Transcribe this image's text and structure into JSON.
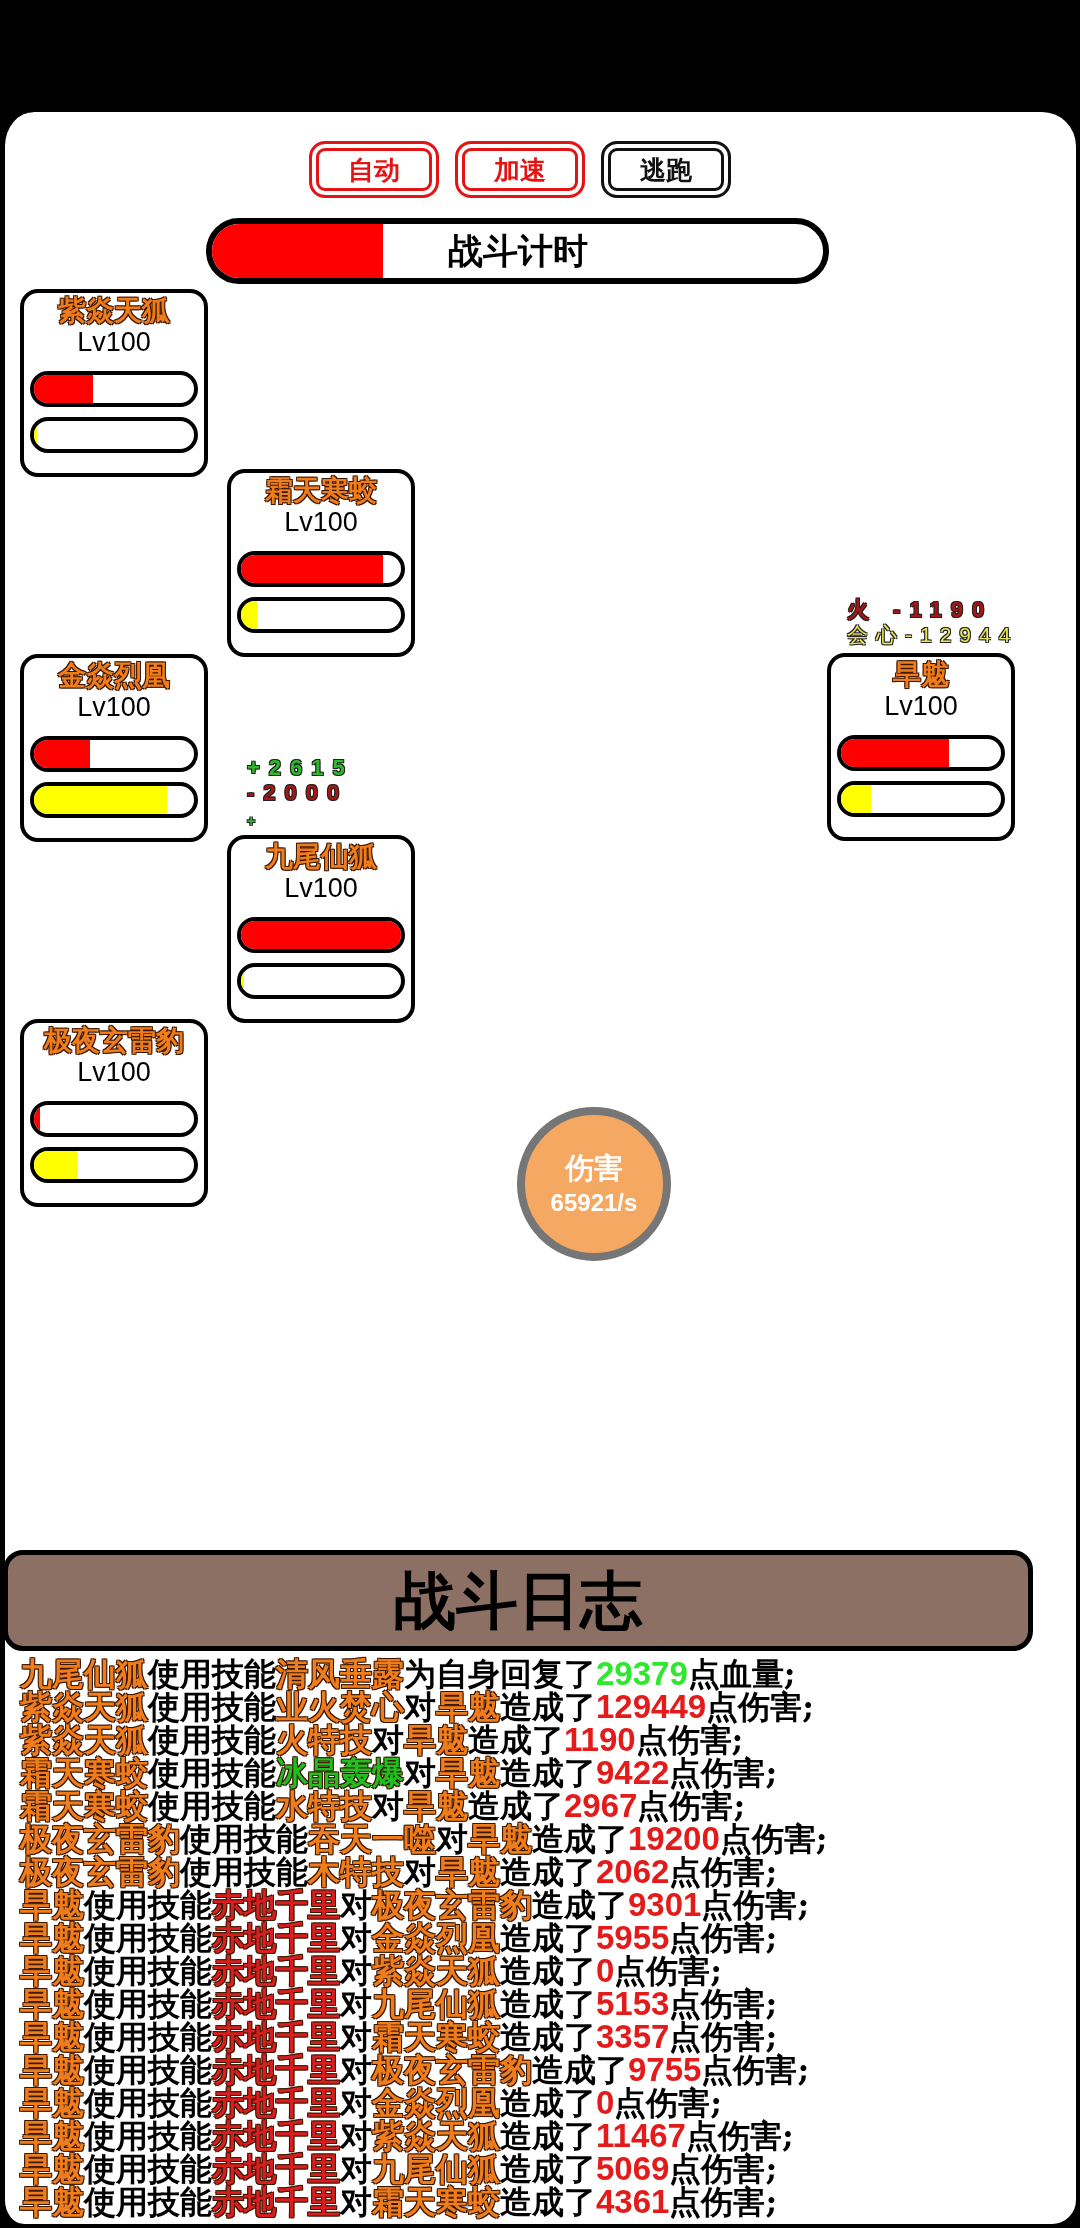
{
  "top_buttons": [
    {
      "label": "自动",
      "on": true
    },
    {
      "label": "加速",
      "on": true
    },
    {
      "label": "逃跑",
      "on": false
    }
  ],
  "timer": {
    "label": "战斗计时",
    "level": 0.28
  },
  "ally_columns": [
    {
      "units": [
        {
          "name": "紫焱天狐",
          "rank": "Lv100",
          "hp_bar": {
            "level": 0.37
          },
          "energy_bar": {
            "level": 0
          }
        },
        {
          "name": "金焱烈凰",
          "rank": "Lv100",
          "hp_bar": {
            "level": 0.35
          },
          "energy_bar": {
            "level": 0.83
          }
        },
        {
          "name": "极夜玄雷豹",
          "rank": "Lv100",
          "hp_bar": {
            "level": 0.04
          },
          "energy_bar": {
            "level": 0.27
          }
        }
      ]
    },
    {
      "units": [
        {
          "name": "霜天寒蛟",
          "rank": "Lv100",
          "hp_bar": {
            "level": 0.885
          },
          "energy_bar": {
            "level": 0.1
          }
        },
        {
          "name": "九尾仙狐",
          "rank": "Lv100",
          "hp_bar": {
            "level": 1
          },
          "energy_bar": {
            "level": 0
          },
          "popups": [
            {
              "text": "+2615",
              "kind": "heal"
            },
            {
              "text": "-2000",
              "kind": "damage"
            },
            {
              "text": "+",
              "kind": "fading"
            }
          ]
        }
      ]
    }
  ],
  "damage_rate": {
    "label": "伤害",
    "value": "65921/s"
  },
  "enemies": [
    {
      "name": "旱魃",
      "rank": "Lv100",
      "hp_bar": {
        "level": 0.675
      },
      "energy_bar": {
        "level": 0.19
      },
      "popups": [
        {
          "text": "火 -1190",
          "kind": "damage"
        },
        {
          "text": "会心-12944",
          "kind": "critical"
        }
      ]
    }
  ],
  "log": {
    "title": "战斗日志",
    "entries": [
      {
        "segments": [
          {
            "text": "九尾仙狐",
            "kind": "unit"
          },
          {
            "text": "使用技能",
            "kind": "text"
          },
          {
            "text": "清风垂露",
            "kind": "skill",
            "color": "#ef7d1b"
          },
          {
            "text": "为自身回复了",
            "kind": "text"
          },
          {
            "text": "29379",
            "kind": "heal"
          },
          {
            "text": "点血量;",
            "kind": "text"
          }
        ]
      },
      {
        "segments": [
          {
            "text": "紫焱天狐",
            "kind": "unit"
          },
          {
            "text": "使用技能",
            "kind": "text"
          },
          {
            "text": "业火焚心",
            "kind": "skill",
            "color": "#ef7d1b"
          },
          {
            "text": "对",
            "kind": "text"
          },
          {
            "text": "旱魃",
            "kind": "unit"
          },
          {
            "text": "造成了",
            "kind": "text"
          },
          {
            "text": "129449",
            "kind": "damage"
          },
          {
            "text": "点伤害;",
            "kind": "text"
          }
        ]
      },
      {
        "segments": [
          {
            "text": "紫焱天狐",
            "kind": "unit"
          },
          {
            "text": "使用技能",
            "kind": "text"
          },
          {
            "text": "火特技",
            "kind": "skill",
            "color": "#ef7d1b"
          },
          {
            "text": "对",
            "kind": "text"
          },
          {
            "text": "旱魃",
            "kind": "unit"
          },
          {
            "text": "造成了",
            "kind": "text"
          },
          {
            "text": "1190",
            "kind": "damage"
          },
          {
            "text": "点伤害;",
            "kind": "text"
          }
        ]
      },
      {
        "segments": [
          {
            "text": "霜天寒蛟",
            "kind": "unit"
          },
          {
            "text": "使用技能",
            "kind": "text"
          },
          {
            "text": "冰晶轰爆",
            "kind": "skill",
            "color": "#1fbf1f"
          },
          {
            "text": "对",
            "kind": "text"
          },
          {
            "text": "旱魃",
            "kind": "unit"
          },
          {
            "text": "造成了",
            "kind": "text"
          },
          {
            "text": "9422",
            "kind": "damage"
          },
          {
            "text": "点伤害;",
            "kind": "text"
          }
        ]
      },
      {
        "segments": [
          {
            "text": "霜天寒蛟",
            "kind": "unit"
          },
          {
            "text": "使用技能",
            "kind": "text"
          },
          {
            "text": "水特技",
            "kind": "skill",
            "color": "#ef7d1b"
          },
          {
            "text": "对",
            "kind": "text"
          },
          {
            "text": "旱魃",
            "kind": "unit"
          },
          {
            "text": "造成了",
            "kind": "text"
          },
          {
            "text": "2967",
            "kind": "damage"
          },
          {
            "text": "点伤害;",
            "kind": "text"
          }
        ]
      },
      {
        "segments": [
          {
            "text": "极夜玄雷豹",
            "kind": "unit"
          },
          {
            "text": "使用技能",
            "kind": "text"
          },
          {
            "text": "吞天一噬",
            "kind": "skill",
            "color": "#ef7d1b"
          },
          {
            "text": "对",
            "kind": "text"
          },
          {
            "text": "旱魃",
            "kind": "unit"
          },
          {
            "text": "造成了",
            "kind": "text"
          },
          {
            "text": "19200",
            "kind": "damage"
          },
          {
            "text": "点伤害;",
            "kind": "text"
          }
        ]
      },
      {
        "segments": [
          {
            "text": "极夜玄雷豹",
            "kind": "unit"
          },
          {
            "text": "使用技能",
            "kind": "text"
          },
          {
            "text": "木特技",
            "kind": "skill",
            "color": "#ef7d1b"
          },
          {
            "text": "对",
            "kind": "text"
          },
          {
            "text": "旱魃",
            "kind": "unit"
          },
          {
            "text": "造成了",
            "kind": "text"
          },
          {
            "text": "2062",
            "kind": "damage"
          },
          {
            "text": "点伤害;",
            "kind": "text"
          }
        ]
      },
      {
        "segments": [
          {
            "text": "旱魃",
            "kind": "unit"
          },
          {
            "text": "使用技能",
            "kind": "text"
          },
          {
            "text": "赤地千里",
            "kind": "skill",
            "color": "#d81e1e"
          },
          {
            "text": "对",
            "kind": "text"
          },
          {
            "text": "极夜玄雷豹",
            "kind": "unit"
          },
          {
            "text": "造成了",
            "kind": "text"
          },
          {
            "text": "9301",
            "kind": "damage"
          },
          {
            "text": "点伤害;",
            "kind": "text"
          }
        ]
      },
      {
        "segments": [
          {
            "text": "旱魃",
            "kind": "unit"
          },
          {
            "text": "使用技能",
            "kind": "text"
          },
          {
            "text": "赤地千里",
            "kind": "skill",
            "color": "#d81e1e"
          },
          {
            "text": "对",
            "kind": "text"
          },
          {
            "text": "金焱烈凰",
            "kind": "unit"
          },
          {
            "text": "造成了",
            "kind": "text"
          },
          {
            "text": "5955",
            "kind": "damage"
          },
          {
            "text": "点伤害;",
            "kind": "text"
          }
        ]
      },
      {
        "segments": [
          {
            "text": "旱魃",
            "kind": "unit"
          },
          {
            "text": "使用技能",
            "kind": "text"
          },
          {
            "text": "赤地千里",
            "kind": "skill",
            "color": "#d81e1e"
          },
          {
            "text": "对",
            "kind": "text"
          },
          {
            "text": "紫焱天狐",
            "kind": "unit"
          },
          {
            "text": "造成了",
            "kind": "text"
          },
          {
            "text": "0",
            "kind": "damage"
          },
          {
            "text": "点伤害;",
            "kind": "text"
          }
        ]
      },
      {
        "segments": [
          {
            "text": "旱魃",
            "kind": "unit"
          },
          {
            "text": "使用技能",
            "kind": "text"
          },
          {
            "text": "赤地千里",
            "kind": "skill",
            "color": "#d81e1e"
          },
          {
            "text": "对",
            "kind": "text"
          },
          {
            "text": "九尾仙狐",
            "kind": "unit"
          },
          {
            "text": "造成了",
            "kind": "text"
          },
          {
            "text": "5153",
            "kind": "damage"
          },
          {
            "text": "点伤害;",
            "kind": "text"
          }
        ]
      },
      {
        "segments": [
          {
            "text": "旱魃",
            "kind": "unit"
          },
          {
            "text": "使用技能",
            "kind": "text"
          },
          {
            "text": "赤地千里",
            "kind": "skill",
            "color": "#d81e1e"
          },
          {
            "text": "对",
            "kind": "text"
          },
          {
            "text": "霜天寒蛟",
            "kind": "unit"
          },
          {
            "text": "造成了",
            "kind": "text"
          },
          {
            "text": "3357",
            "kind": "damage"
          },
          {
            "text": "点伤害;",
            "kind": "text"
          }
        ]
      },
      {
        "segments": [
          {
            "text": "旱魃",
            "kind": "unit"
          },
          {
            "text": "使用技能",
            "kind": "text"
          },
          {
            "text": "赤地千里",
            "kind": "skill",
            "color": "#d81e1e"
          },
          {
            "text": "对",
            "kind": "text"
          },
          {
            "text": "极夜玄雷豹",
            "kind": "unit"
          },
          {
            "text": "造成了",
            "kind": "text"
          },
          {
            "text": "9755",
            "kind": "damage"
          },
          {
            "text": "点伤害;",
            "kind": "text"
          }
        ]
      },
      {
        "segments": [
          {
            "text": "旱魃",
            "kind": "unit"
          },
          {
            "text": "使用技能",
            "kind": "text"
          },
          {
            "text": "赤地千里",
            "kind": "skill",
            "color": "#d81e1e"
          },
          {
            "text": "对",
            "kind": "text"
          },
          {
            "text": "金焱烈凰",
            "kind": "unit"
          },
          {
            "text": "造成了",
            "kind": "text"
          },
          {
            "text": "0",
            "kind": "damage"
          },
          {
            "text": "点伤害;",
            "kind": "text"
          }
        ]
      },
      {
        "segments": [
          {
            "text": "旱魃",
            "kind": "unit"
          },
          {
            "text": "使用技能",
            "kind": "text"
          },
          {
            "text": "赤地千里",
            "kind": "skill",
            "color": "#d81e1e"
          },
          {
            "text": "对",
            "kind": "text"
          },
          {
            "text": "紫焱天狐",
            "kind": "unit"
          },
          {
            "text": "造成了",
            "kind": "text"
          },
          {
            "text": "11467",
            "kind": "damage"
          },
          {
            "text": "点伤害;",
            "kind": "text"
          }
        ]
      },
      {
        "segments": [
          {
            "text": "旱魃",
            "kind": "unit"
          },
          {
            "text": "使用技能",
            "kind": "text"
          },
          {
            "text": "赤地千里",
            "kind": "skill",
            "color": "#d81e1e"
          },
          {
            "text": "对",
            "kind": "text"
          },
          {
            "text": "九尾仙狐",
            "kind": "unit"
          },
          {
            "text": "造成了",
            "kind": "text"
          },
          {
            "text": "5069",
            "kind": "damage"
          },
          {
            "text": "点伤害;",
            "kind": "text"
          }
        ]
      },
      {
        "segments": [
          {
            "text": "旱魃",
            "kind": "unit"
          },
          {
            "text": "使用技能",
            "kind": "text"
          },
          {
            "text": "赤地千里",
            "kind": "skill",
            "color": "#d81e1e"
          },
          {
            "text": "对",
            "kind": "text"
          },
          {
            "text": "霜天寒蛟",
            "kind": "unit"
          },
          {
            "text": "造成了",
            "kind": "text"
          },
          {
            "text": "4361",
            "kind": "damage"
          },
          {
            "text": "点伤害;",
            "kind": "text"
          }
        ]
      }
    ]
  }
}
